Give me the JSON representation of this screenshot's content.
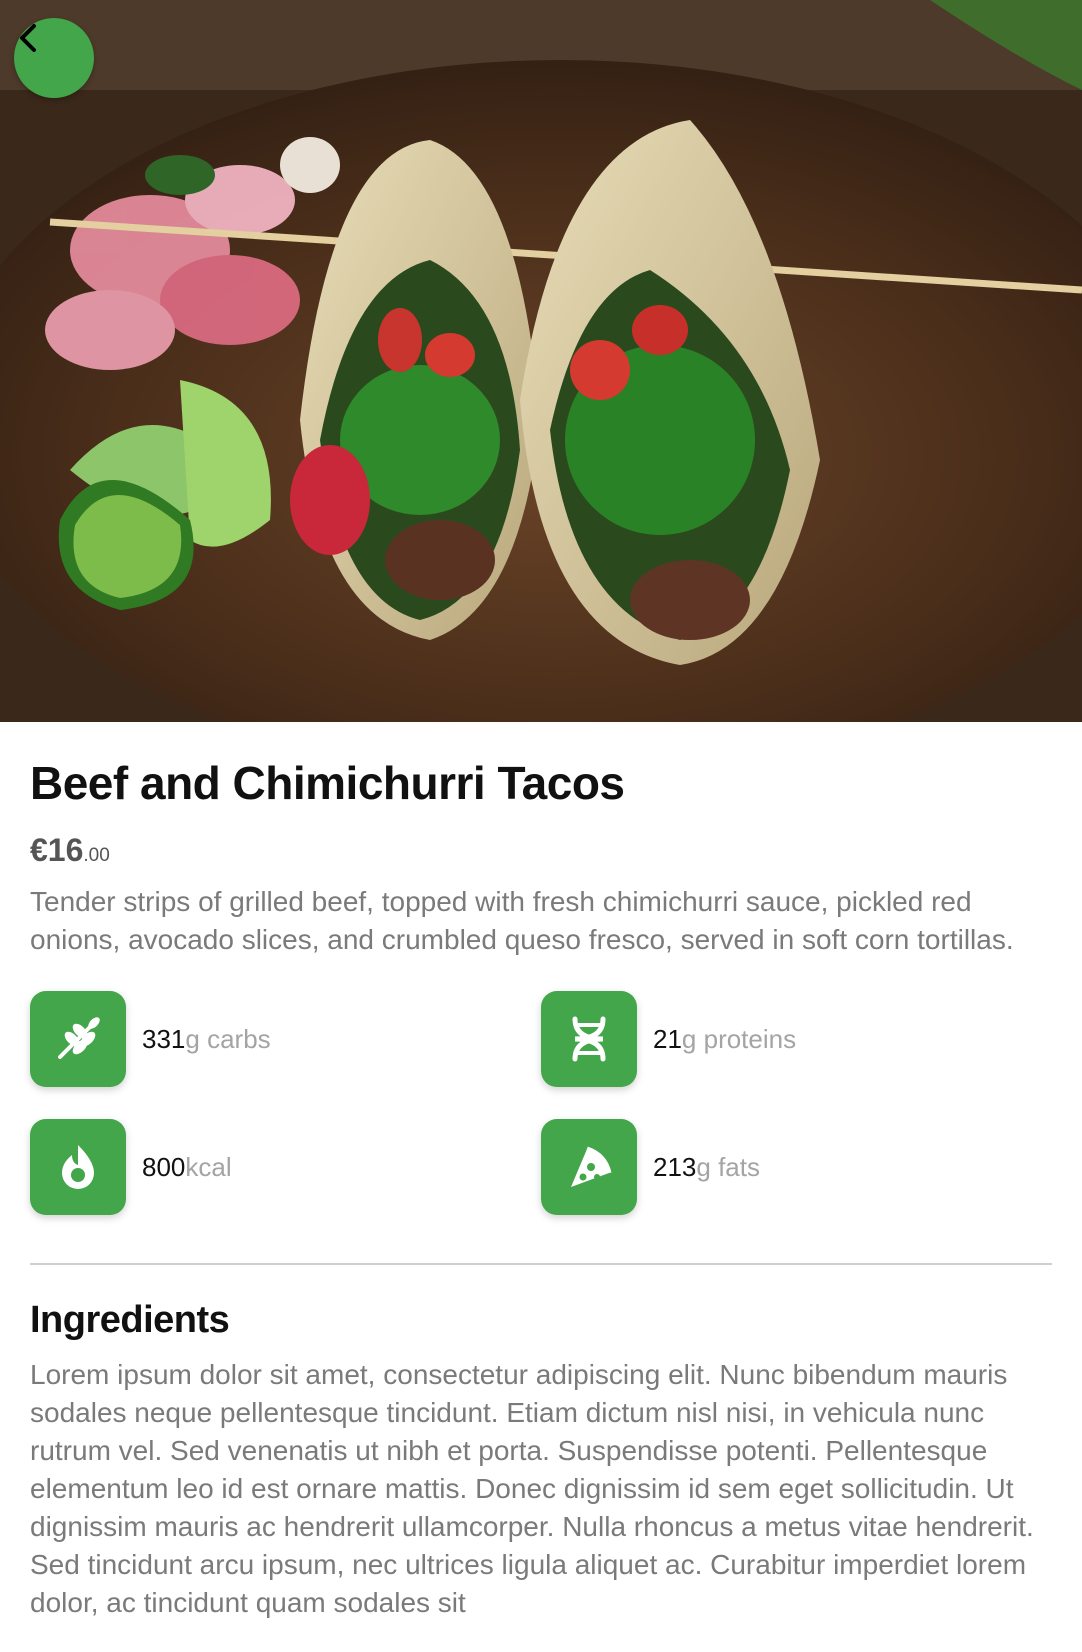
{
  "product": {
    "title": "Beef and Chimichurri Tacos",
    "price_int": "€16",
    "price_dec": ".00",
    "description": "Tender strips of grilled beef, topped with fresh chimichurri sauce, pickled red onions, avocado slices, and crumbled queso fresco, served in soft corn tortillas."
  },
  "nutrition": {
    "carbs": {
      "value": "331",
      "unit": "g carbs",
      "icon": "wheat-icon"
    },
    "proteins": {
      "value": "21",
      "unit": "g proteins",
      "icon": "dna-icon"
    },
    "kcal": {
      "value": "800",
      "unit": " kcal",
      "icon": "flame-icon"
    },
    "fats": {
      "value": "213",
      "unit": "g fats",
      "icon": "pizza-slice-icon"
    }
  },
  "ingredients": {
    "title": "Ingredients",
    "text": "Lorem ipsum dolor sit amet, consectetur adipiscing elit. Nunc bibendum mauris sodales neque pellentesque tincidunt. Etiam dictum nisl nisi, in vehicula nunc rutrum vel. Sed venenatis ut nibh et porta. Suspendisse potenti. Pellentesque elementum leo id est ornare mattis. Donec dignissim id sem eget sollicitudin. Ut dignissim mauris ac hendrerit ullamcorper. Nulla rhoncus a metus vitae hendrerit. Sed tincidunt arcu ipsum, nec ultrices ligula aliquet ac. Curabitur imperdiet lorem dolor, ac tincidunt quam sodales sit"
  },
  "colors": {
    "accent": "#43a64a"
  }
}
